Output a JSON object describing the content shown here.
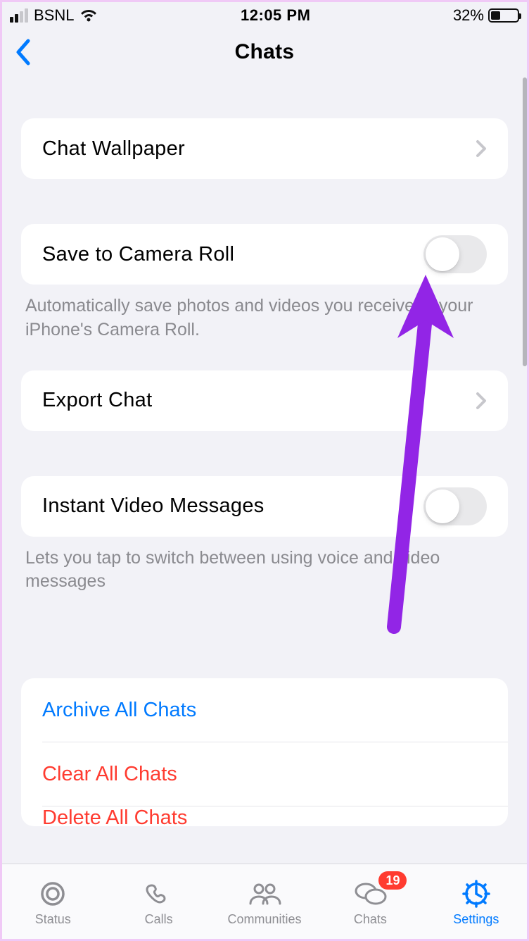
{
  "status": {
    "carrier": "BSNL",
    "time": "12:05 PM",
    "battery_pct": "32%",
    "battery_fill_pct": 32
  },
  "nav": {
    "title": "Chats"
  },
  "rows": {
    "wallpaper": "Chat Wallpaper",
    "save_roll": "Save to Camera Roll",
    "save_roll_footer": "Automatically save photos and videos you receive to your iPhone's Camera Roll.",
    "export": "Export Chat",
    "instant_video": "Instant Video Messages",
    "instant_video_footer": "Lets you tap to switch between using voice and video messages",
    "archive": "Archive All Chats",
    "clear": "Clear All Chats",
    "delete": "Delete All Chats"
  },
  "tabs": {
    "status": "Status",
    "calls": "Calls",
    "communities": "Communities",
    "chats": "Chats",
    "chats_badge": "19",
    "settings": "Settings"
  },
  "colors": {
    "accent": "#007aff",
    "destructive": "#ff3b30",
    "arrow": "#8a2be2"
  }
}
